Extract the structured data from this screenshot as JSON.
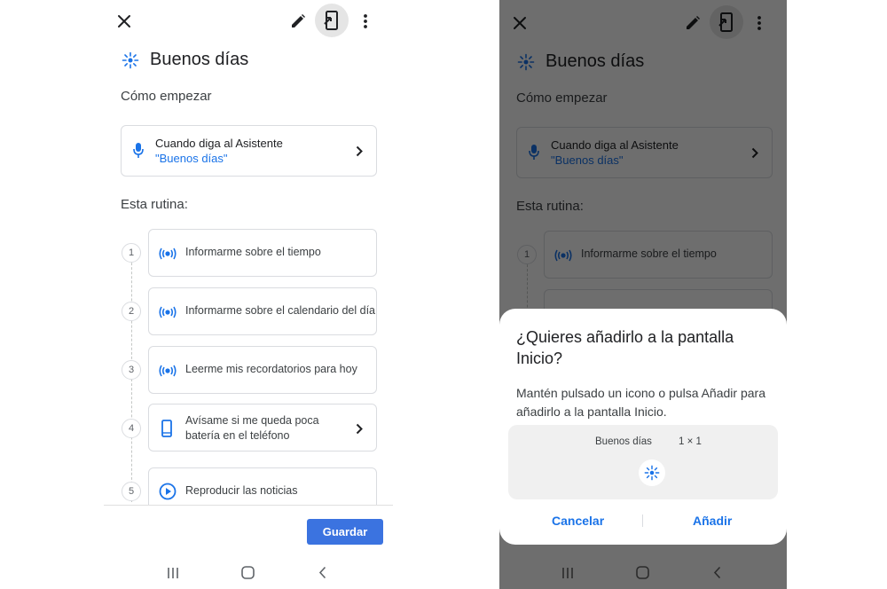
{
  "screen": {
    "title": "Buenos días",
    "section_start": "Cómo empezar",
    "trigger": {
      "main": "Cuando diga al Asistente",
      "phrase": "\"Buenos días\""
    },
    "section_routine": "Esta rutina:",
    "steps": [
      {
        "number": "1",
        "label": "Informarme sobre el tiempo",
        "icon": "broadcast-icon"
      },
      {
        "number": "2",
        "label": "Informarme sobre el calendario del día",
        "icon": "broadcast-icon"
      },
      {
        "number": "3",
        "label": "Leerme mis recordatorios para hoy",
        "icon": "broadcast-icon"
      },
      {
        "number": "4",
        "label": "Avísame si me queda poca batería en el teléfono",
        "icon": "phone-icon"
      },
      {
        "number": "5",
        "label": "Reproducir las noticias",
        "icon": "play-icon"
      }
    ],
    "save_label": "Guardar"
  },
  "dialog": {
    "title": "¿Quieres añadirlo a la pantalla Inicio?",
    "body": "Mantén pulsado un icono o pulsa Añadir para añadirlo a la pantalla Inicio.",
    "widget_name": "Buenos días",
    "widget_size": "1 × 1",
    "cancel_label": "Cancelar",
    "add_label": "Añadir"
  },
  "colors": {
    "accent": "#1a73e8",
    "save_button": "#3b73e0",
    "scrim": "#000000"
  },
  "icons": [
    "close-icon",
    "edit-pencil-icon",
    "add-to-home-icon",
    "more-vert-icon",
    "sparkle-icon",
    "mic-icon",
    "chevron-right-icon",
    "recents-icon",
    "home-icon",
    "back-icon"
  ]
}
